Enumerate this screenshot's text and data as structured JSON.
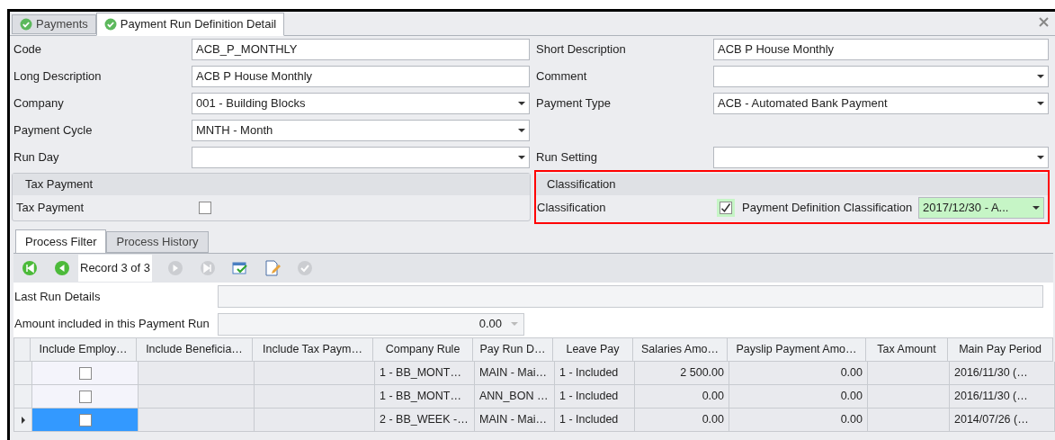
{
  "tabs": [
    {
      "label": "Payments",
      "selected": false
    },
    {
      "label": "Payment Run Definition Detail",
      "selected": true
    }
  ],
  "form_rows": [
    {
      "left": {
        "label": "Code",
        "value": "ACB_P_MONTHLY",
        "kind": "text"
      },
      "right": {
        "label": "Short Description",
        "value": "ACB P House Monthly",
        "kind": "text"
      }
    },
    {
      "left": {
        "label": "Long Description",
        "value": "ACB P House Monthly",
        "kind": "text"
      },
      "right": {
        "label": "Comment",
        "kind": "dropdown"
      }
    },
    {
      "left": {
        "label": "Company",
        "value": "001 - Building Blocks",
        "kind": "dropdown"
      },
      "right": {
        "label": "Payment Type",
        "value": "ACB - Automated Bank Payment",
        "kind": "dropdown"
      }
    },
    {
      "left": {
        "label": "Payment Cycle",
        "value": "MNTH - Month",
        "kind": "dropdown"
      }
    },
    {
      "left": {
        "label": "Run Day",
        "kind": "dropdown"
      },
      "right": {
        "label": "Run Setting",
        "kind": "dropdown"
      }
    }
  ],
  "tax_group": {
    "title": "Tax Payment",
    "label": "Tax Payment",
    "checked": false
  },
  "classification_group": {
    "title": "Classification",
    "label": "Classification",
    "checked": true,
    "highlighted": true,
    "field_label": "Payment Definition Classification",
    "field_value": "2017/12/30 - A..."
  },
  "sub_tabs": [
    {
      "label": "Process Filter",
      "selected": true
    },
    {
      "label": "Process History",
      "selected": false
    }
  ],
  "navigator": {
    "record": "Record 3 of 3",
    "buttons": [
      {
        "kind": "first",
        "disabled": false
      },
      {
        "kind": "prev",
        "disabled": false
      },
      {
        "kind": "next",
        "disabled": true
      },
      {
        "kind": "last",
        "disabled": true
      },
      {
        "kind": "refresh",
        "disabled": false
      },
      {
        "kind": "edit",
        "disabled": false
      },
      {
        "kind": "apply",
        "disabled": true
      }
    ]
  },
  "last_run": {
    "label": "Last Run Details"
  },
  "amount": {
    "label": "Amount included in this Payment Run",
    "value": "0.00"
  },
  "table": {
    "columns": [
      "Include Employ…",
      "Include Beneficia…",
      "Include Tax Paym…",
      "Company Rule",
      "Pay Run D…",
      "Leave Pay",
      "Salaries Amo…",
      "Payslip Payment Amo…",
      "Tax Amount",
      "Main Pay Period"
    ],
    "rows": [
      {
        "selected": false,
        "include_employee": false,
        "company_rule": "1 - BB_MONT…",
        "pay_run": "MAIN - Mai…",
        "leave_pay": "1 - Included",
        "salaries": "2 500.00",
        "payslip": "0.00",
        "main_pay_period": "2016/11/30 (…"
      },
      {
        "selected": false,
        "include_employee": false,
        "company_rule": "1 - BB_MONT…",
        "pay_run": "ANN_BON …",
        "leave_pay": "1 - Included",
        "salaries": "0.00",
        "payslip": "0.00",
        "main_pay_period": "2016/11/30 (…"
      },
      {
        "selected": true,
        "include_employee": false,
        "company_rule": "2 - BB_WEEK -…",
        "pay_run": "MAIN - Mai…",
        "leave_pay": "1 - Included",
        "salaries": "0.00",
        "payslip": "0.00",
        "main_pay_period": "2014/07/26 (…"
      }
    ]
  }
}
